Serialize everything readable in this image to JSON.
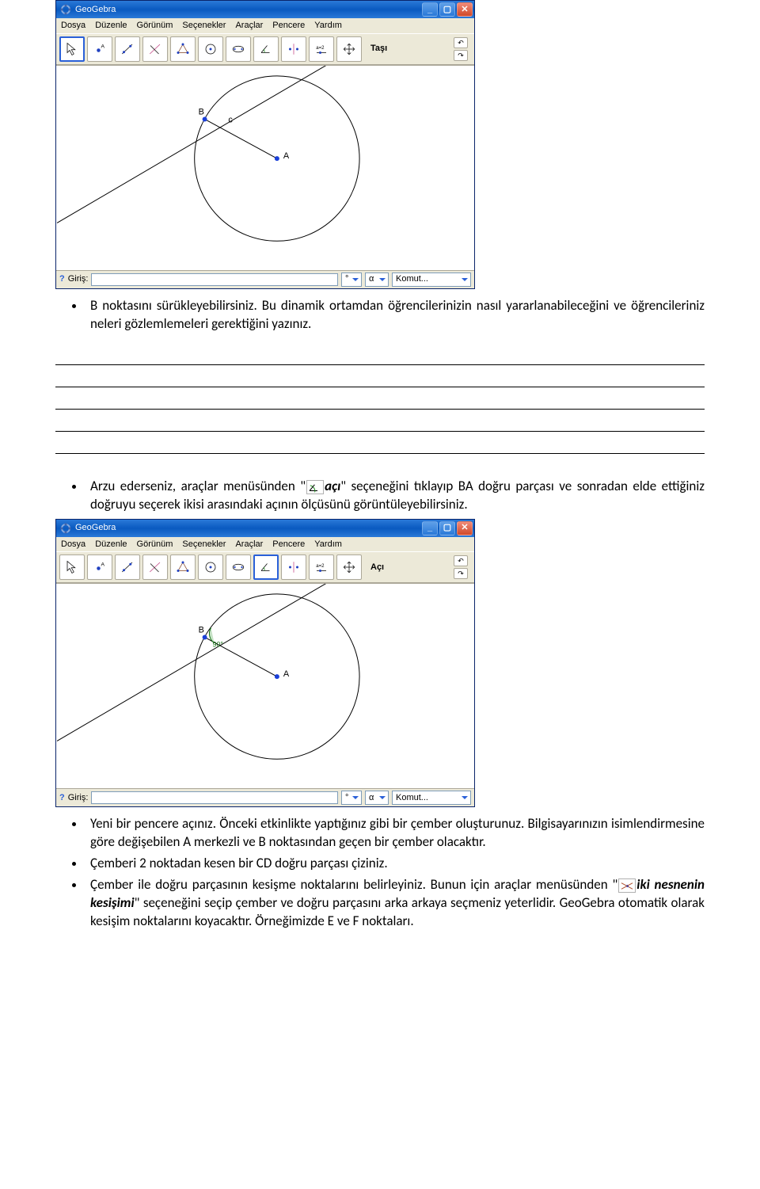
{
  "app": {
    "title": "GeoGebra",
    "menu": [
      "Dosya",
      "Düzenle",
      "Görünüm",
      "Seçenekler",
      "Araçlar",
      "Pencere",
      "Yardım"
    ]
  },
  "window1": {
    "tool_label": "Taşı",
    "canvas": {
      "pointA_label": "A",
      "pointB_label": "B",
      "edge_label": "c"
    }
  },
  "window2": {
    "tool_label": "Açı",
    "canvas": {
      "pointA_label": "A",
      "pointB_label": "B",
      "angle_text": "90°"
    }
  },
  "statusbar": {
    "label_giris": "Giriş:",
    "alpha": "α",
    "komut": "Komut..."
  },
  "doc": {
    "p1": "B noktasını sürükleyebilirsiniz. Bu dinamik ortamdan öğrencilerinizin nasıl yararlanabileceğini ve öğrencileriniz neleri gözlemlemeleri gerektiğini yazınız.",
    "p2a": "Arzu ederseniz, araçlar menüsünden \"",
    "p2b": "açı",
    "p2c": "\" seçeneğini tıklayıp BA doğru parçası ve sonradan elde ettiğiniz doğruyu seçerek ikisi arasındaki açının ölçüsünü görüntüleyebilirsiniz.",
    "p3": "Yeni bir pencere açınız. Önceki etkinlikte yaptığınız gibi bir çember oluşturunuz. Bilgisayarınızın isimlendirmesine göre değişebilen A merkezli ve B noktasından geçen bir çember olacaktır.",
    "p4": "Çemberi 2 noktadan kesen bir CD doğru parçası çiziniz.",
    "p5a": "Çember ile doğru parçasının kesişme noktalarını belirleyiniz. Bunun için araçlar menüsünden \"",
    "p5b": "iki nesnenin kesişimi",
    "p5c": "\" seçeneğini seçip çember ve doğru parçasını arka arkaya seçmeniz yeterlidir. GeoGebra otomatik olarak kesişim noktalarını koyacaktır. Örneğimizde E ve F noktaları."
  }
}
